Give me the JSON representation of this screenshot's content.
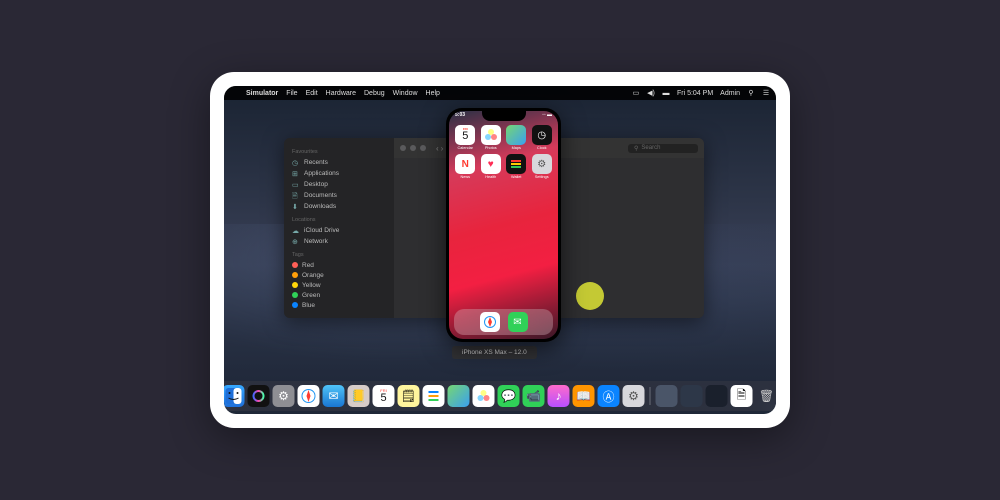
{
  "menubar": {
    "app_name": "Simulator",
    "menus": [
      "File",
      "Edit",
      "Hardware",
      "Debug",
      "Window",
      "Help"
    ],
    "time": "Fri 5:04 PM",
    "user": "Admin"
  },
  "finder": {
    "sections": {
      "favourites": {
        "header": "Favourites",
        "items": [
          {
            "icon": "clock-icon",
            "label": "Recents"
          },
          {
            "icon": "app-icon",
            "label": "Applications"
          },
          {
            "icon": "desktop-icon",
            "label": "Desktop"
          },
          {
            "icon": "doc-icon",
            "label": "Documents"
          },
          {
            "icon": "download-icon",
            "label": "Downloads"
          }
        ]
      },
      "locations": {
        "header": "Locations",
        "items": [
          {
            "icon": "cloud-icon",
            "label": "iCloud Drive"
          },
          {
            "icon": "network-icon",
            "label": "Network"
          }
        ]
      },
      "tags": {
        "header": "Tags",
        "items": [
          {
            "color": "#ff5f57",
            "label": "Red"
          },
          {
            "color": "#ff9f0a",
            "label": "Orange"
          },
          {
            "color": "#ffd60a",
            "label": "Yellow"
          },
          {
            "color": "#30d158",
            "label": "Green"
          },
          {
            "color": "#0a84ff",
            "label": "Blue"
          }
        ]
      }
    },
    "search_placeholder": "Search"
  },
  "phone": {
    "status_time": "5:03",
    "apps_row1": [
      {
        "name": "Calendar",
        "bg": "#fff",
        "day": "5",
        "weekday": "FRI"
      },
      {
        "name": "Photos",
        "bg": "#fff"
      },
      {
        "name": "Maps",
        "bg": "linear-gradient(135deg,#76d672,#3aa0f0)"
      },
      {
        "name": "Clock",
        "bg": "#111"
      }
    ],
    "apps_row2": [
      {
        "name": "News",
        "bg": "#fff",
        "accent": "#ff3b30"
      },
      {
        "name": "Health",
        "bg": "#fff",
        "accent": "#ff2d55"
      },
      {
        "name": "Wallet",
        "bg": "#111"
      },
      {
        "name": "Settings",
        "bg": "#d8d8dc"
      }
    ],
    "dock": [
      {
        "name": "Safari",
        "bg": "#fff"
      },
      {
        "name": "Messages",
        "bg": "#30d158"
      }
    ],
    "device_label": "iPhone XS Max – 12.0"
  },
  "dock_icons": [
    {
      "name": "finder",
      "bg": "linear-gradient(#36a8ff,#1e6fd9)"
    },
    {
      "name": "siri",
      "bg": "#111"
    },
    {
      "name": "launchpad",
      "bg": "#8e8e93"
    },
    {
      "name": "safari",
      "bg": "#fff"
    },
    {
      "name": "mail",
      "bg": "linear-gradient(#4fc3f7,#1976d2)"
    },
    {
      "name": "contacts",
      "bg": "#d7ccc8"
    },
    {
      "name": "calendar",
      "bg": "#fff"
    },
    {
      "name": "notes",
      "bg": "#fff59d"
    },
    {
      "name": "reminders",
      "bg": "#fff"
    },
    {
      "name": "maps",
      "bg": "linear-gradient(135deg,#76d672,#3aa0f0)"
    },
    {
      "name": "photos",
      "bg": "#fff"
    },
    {
      "name": "messages",
      "bg": "#30d158"
    },
    {
      "name": "facetime",
      "bg": "#30d158"
    },
    {
      "name": "itunes",
      "bg": "linear-gradient(#ff6bcb,#b84fff)"
    },
    {
      "name": "ibooks",
      "bg": "#ff9500"
    },
    {
      "name": "appstore",
      "bg": "#0a84ff"
    },
    {
      "name": "preferences",
      "bg": "#d8d8dc"
    },
    {
      "name": "app1",
      "bg": "#4a5568"
    },
    {
      "name": "app2",
      "bg": "#2d3748"
    },
    {
      "name": "app3",
      "bg": "#1a202c"
    },
    {
      "name": "textedit",
      "bg": "#fff"
    },
    {
      "name": "trash",
      "bg": "#d8d8dc"
    }
  ]
}
